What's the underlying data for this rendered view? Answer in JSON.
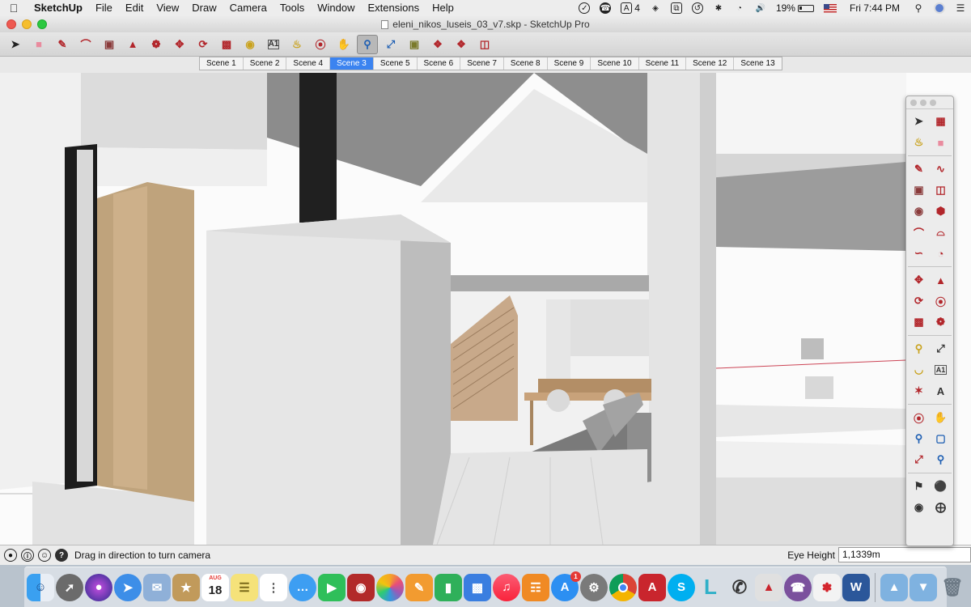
{
  "menubar": {
    "app_name": "SketchUp",
    "menus": [
      "File",
      "Edit",
      "View",
      "Draw",
      "Camera",
      "Tools",
      "Window",
      "Extensions",
      "Help"
    ],
    "status": {
      "adobe_count": "4",
      "battery": "19%",
      "clock": "Fri 7:44 PM"
    }
  },
  "window": {
    "title": "eleni_nikos_luseis_03_v7.skp - SketchUp Pro"
  },
  "toolbar": {
    "tools": [
      "select-tool",
      "eraser-tool",
      "pencil-tool",
      "arc-tool",
      "rectangle-tool",
      "push-pull-tool",
      "move-tool",
      "offset-tool",
      "rotate-tool",
      "scale-tool",
      "tape-measure-tool",
      "text-tool",
      "paint-bucket-tool",
      "orbit-tool",
      "pan-tool",
      "zoom-tool",
      "zoom-extents-tool",
      "3d-warehouse-tool",
      "extension-warehouse-tool",
      "layout-tool",
      "send-to-layout-tool"
    ],
    "active_tool": "zoom-tool"
  },
  "scenes": {
    "tabs": [
      "Scene 1",
      "Scene 2",
      "Scene 4",
      "Scene 3",
      "Scene 5",
      "Scene 6",
      "Scene 7",
      "Scene 8",
      "Scene 9",
      "Scene 10",
      "Scene 11",
      "Scene 12",
      "Scene 13"
    ],
    "active": "Scene 3"
  },
  "statusbar": {
    "message": "Drag in direction to turn camera",
    "measurement_label": "Eye Height",
    "measurement_value": "1,1339m"
  },
  "dock": {
    "calendar_month": "AUG",
    "calendar_day": "18",
    "appstore_badge": "1"
  },
  "colors": {
    "accent": "#3b83f0",
    "tool_red": "#b2262b",
    "viewport_bg": "#fafafa"
  }
}
